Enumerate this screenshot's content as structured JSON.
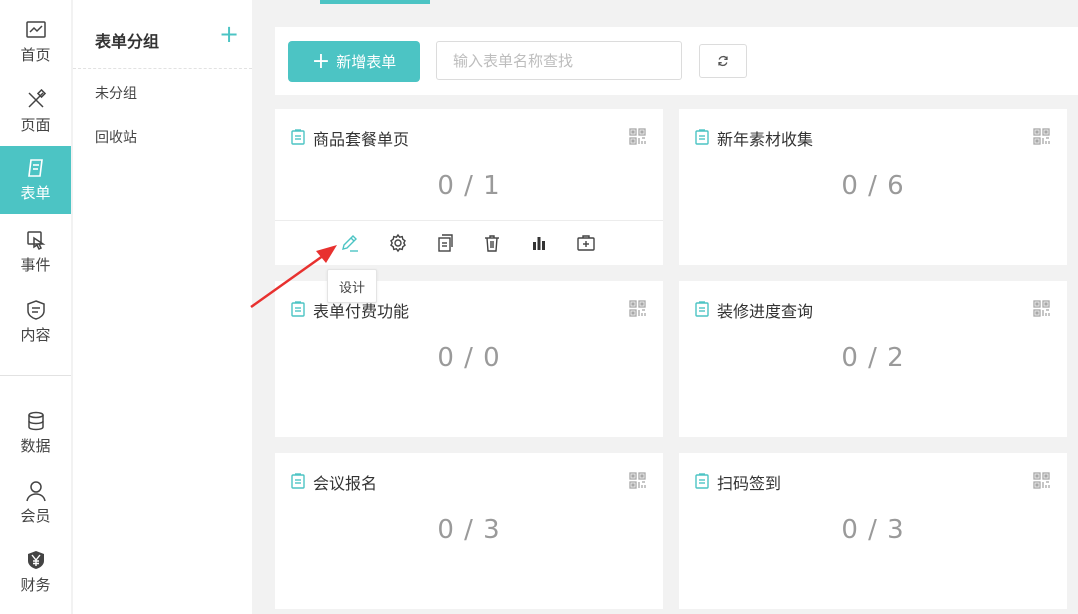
{
  "nav": {
    "items": [
      {
        "label": "首页",
        "icon": "chart-icon"
      },
      {
        "label": "页面",
        "icon": "design-tools-icon"
      },
      {
        "label": "表单",
        "icon": "form-icon",
        "active": true
      },
      {
        "label": "事件",
        "icon": "touch-icon"
      },
      {
        "label": "内容",
        "icon": "content-shield-icon"
      },
      {
        "label": "数据",
        "icon": "database-icon"
      },
      {
        "label": "会员",
        "icon": "user-icon"
      },
      {
        "label": "财务",
        "icon": "yen-icon"
      }
    ]
  },
  "groups": {
    "title": "表单分组",
    "add_icon": "+",
    "items": [
      "未分组",
      "回收站"
    ]
  },
  "toolbar": {
    "add_label": "新增表单",
    "add_icon": "+",
    "search_placeholder": "输入表单名称查找"
  },
  "cards": [
    {
      "title": "商品套餐单页",
      "count": "0 / 1"
    },
    {
      "title": "新年素材收集",
      "count": "0 / 6"
    },
    {
      "title": "表单付费功能",
      "count": "0 / 0"
    },
    {
      "title": "装修进度查询",
      "count": "0 / 2"
    },
    {
      "title": "会议报名",
      "count": "0 / 3"
    },
    {
      "title": "扫码签到",
      "count": "0 / 3"
    }
  ],
  "tooltip": {
    "text": "设计"
  },
  "colors": {
    "accent": "#4cc4c4",
    "arrow": "#e8312f"
  }
}
